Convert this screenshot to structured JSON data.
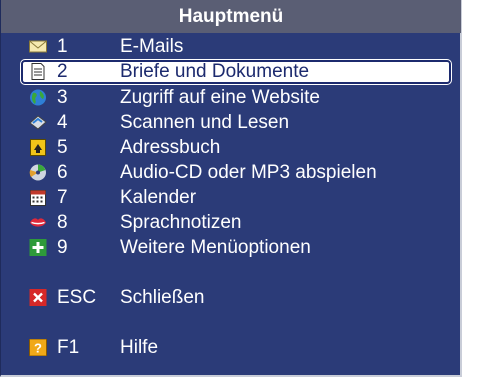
{
  "menu": {
    "title": "Hauptmenü",
    "items": [
      {
        "key": "1",
        "label": "E-Mails",
        "icon": "envelope-icon"
      },
      {
        "key": "2",
        "label": "Briefe und Dokumente",
        "icon": "document-icon"
      },
      {
        "key": "3",
        "label": "Zugriff auf eine Website",
        "icon": "globe-icon"
      },
      {
        "key": "4",
        "label": "Scannen und Lesen",
        "icon": "scanner-icon"
      },
      {
        "key": "5",
        "label": "Adressbuch",
        "icon": "address-book-icon"
      },
      {
        "key": "6",
        "label": "Audio-CD oder MP3 abspielen",
        "icon": "cd-icon"
      },
      {
        "key": "7",
        "label": "Kalender",
        "icon": "calendar-icon"
      },
      {
        "key": "8",
        "label": "Sprachnotizen",
        "icon": "lips-icon"
      },
      {
        "key": "9",
        "label": "Weitere Menüoptionen",
        "icon": "plus-icon"
      }
    ],
    "close": {
      "key": "ESC",
      "label": "Schließen",
      "icon": "close-icon"
    },
    "help": {
      "key": "F1",
      "label": "Hilfe",
      "icon": "help-icon"
    }
  },
  "colors": {
    "background": "#2b3b78",
    "title_bar": "#5a5e74",
    "selected_text": "#1c2a6e"
  }
}
